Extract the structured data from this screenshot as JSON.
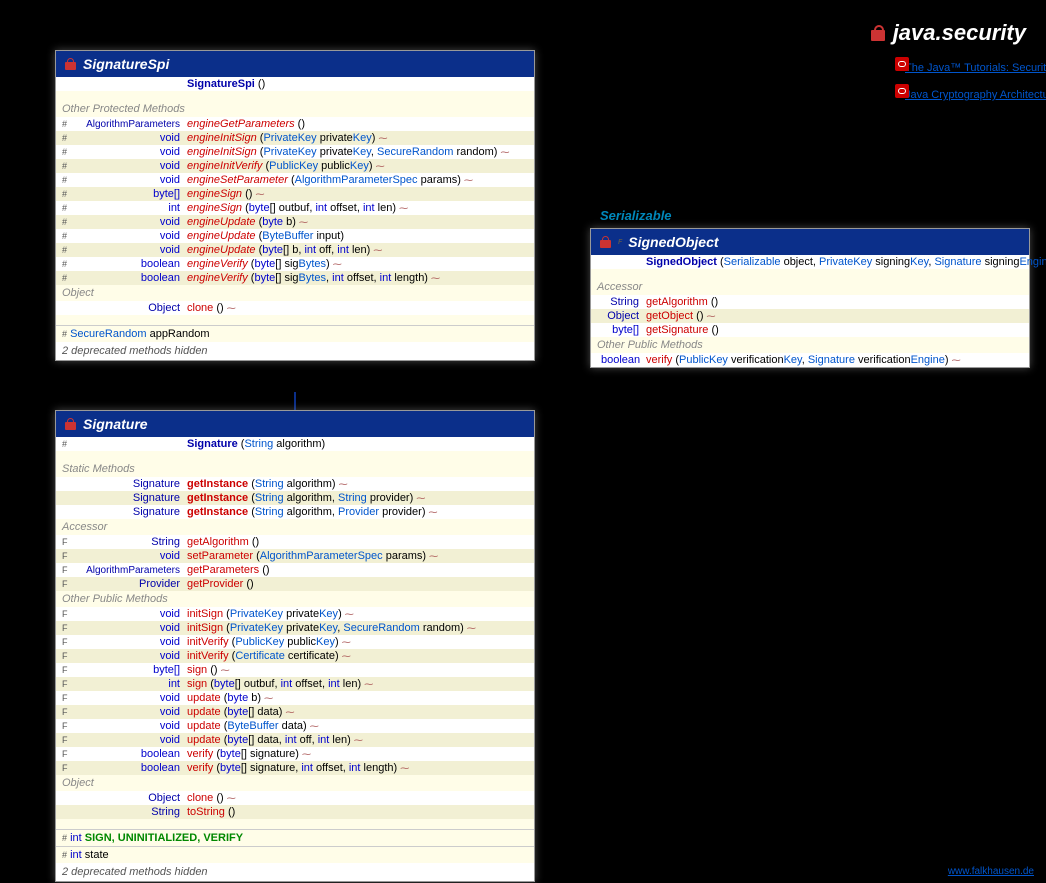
{
  "page": {
    "title": "java.security",
    "footer": "www.falkhausen.de"
  },
  "links": {
    "l1": "The Java™ Tutorials: Security Features in Java SE: Table of Contents",
    "l2": "Java Cryptography Architecture (JCA) Reference Guide"
  },
  "interface_label": "Serializable",
  "cards": {
    "sigspi": {
      "title": "SignatureSpi",
      "ctor": {
        "name": "SignatureSpi",
        "params": "()"
      },
      "sec1": "Other Protected Methods",
      "rows": [
        {
          "mod": "#",
          "ret": "AlgorithmParameters",
          "name": "engineGetParameters",
          "params": "()"
        },
        {
          "mod": "#",
          "ret": "void",
          "name": "engineInitSign",
          "params": "(PrivateKey privateKey)",
          "th": 1
        },
        {
          "mod": "#",
          "ret": "void",
          "name": "engineInitSign",
          "params": "(PrivateKey privateKey, SecureRandom random)",
          "th": 1
        },
        {
          "mod": "#",
          "ret": "void",
          "name": "engineInitVerify",
          "params": "(PublicKey publicKey)",
          "th": 1
        },
        {
          "mod": "#",
          "ret": "void",
          "name": "engineSetParameter",
          "params": "(AlgorithmParameterSpec params)",
          "th": 1
        },
        {
          "mod": "#",
          "ret": "byte[]",
          "name": "engineSign",
          "params": "()",
          "th": 1
        },
        {
          "mod": "#",
          "ret": "int",
          "name": "engineSign",
          "params": "(byte[] outbuf, int offset, int len)",
          "th": 1
        },
        {
          "mod": "#",
          "ret": "void",
          "name": "engineUpdate",
          "params": "(byte b)",
          "th": 1
        },
        {
          "mod": "#",
          "ret": "void",
          "name": "engineUpdate",
          "params": "(ByteBuffer input)"
        },
        {
          "mod": "#",
          "ret": "void",
          "name": "engineUpdate",
          "params": "(byte[] b, int off, int len)",
          "th": 1
        },
        {
          "mod": "#",
          "ret": "boolean",
          "name": "engineVerify",
          "params": "(byte[] sigBytes)",
          "th": 1
        },
        {
          "mod": "#",
          "ret": "boolean",
          "name": "engineVerify",
          "params": "(byte[] sigBytes, int offset, int length)",
          "th": 1
        }
      ],
      "sec2": "Object",
      "obj_rows": [
        {
          "mod": "",
          "ret": "Object",
          "name": "clone",
          "params": "()",
          "th": 1
        }
      ],
      "field": {
        "mod": "#",
        "type": "SecureRandom",
        "name": "appRandom"
      },
      "hidden": "2 deprecated methods hidden"
    },
    "sig": {
      "title": "Signature",
      "ctor": {
        "mod": "#",
        "name": "Signature",
        "params": "(String algorithm)"
      },
      "sec_static": "Static Methods",
      "static_rows": [
        {
          "ret": "Signature",
          "name": "getInstance",
          "params": "(String algorithm)",
          "th": 1
        },
        {
          "ret": "Signature",
          "name": "getInstance",
          "params": "(String algorithm, String provider)",
          "th": 1
        },
        {
          "ret": "Signature",
          "name": "getInstance",
          "params": "(String algorithm, Provider provider)",
          "th": 1
        }
      ],
      "sec_acc": "Accessor",
      "acc_rows": [
        {
          "mod": "F",
          "ret": "String",
          "name": "getAlgorithm",
          "params": "()"
        },
        {
          "mod": "F",
          "ret": "void",
          "name": "setParameter",
          "params": "(AlgorithmParameterSpec params)",
          "th": 1
        },
        {
          "mod": "F",
          "ret": "AlgorithmParameters",
          "name": "getParameters",
          "params": "()"
        },
        {
          "mod": "F",
          "ret": "Provider",
          "name": "getProvider",
          "params": "()"
        }
      ],
      "sec_pub": "Other Public Methods",
      "pub_rows": [
        {
          "mod": "F",
          "ret": "void",
          "name": "initSign",
          "params": "(PrivateKey privateKey)",
          "th": 1
        },
        {
          "mod": "F",
          "ret": "void",
          "name": "initSign",
          "params": "(PrivateKey privateKey, SecureRandom random)",
          "th": 1
        },
        {
          "mod": "F",
          "ret": "void",
          "name": "initVerify",
          "params": "(PublicKey publicKey)",
          "th": 1
        },
        {
          "mod": "F",
          "ret": "void",
          "name": "initVerify",
          "params": "(Certificate certificate)",
          "th": 1
        },
        {
          "mod": "F",
          "ret": "byte[]",
          "name": "sign",
          "params": "()",
          "th": 1
        },
        {
          "mod": "F",
          "ret": "int",
          "name": "sign",
          "params": "(byte[] outbuf, int offset, int len)",
          "th": 1
        },
        {
          "mod": "F",
          "ret": "void",
          "name": "update",
          "params": "(byte b)",
          "th": 1
        },
        {
          "mod": "F",
          "ret": "void",
          "name": "update",
          "params": "(byte[] data)",
          "th": 1
        },
        {
          "mod": "F",
          "ret": "void",
          "name": "update",
          "params": "(ByteBuffer data)",
          "th": 1
        },
        {
          "mod": "F",
          "ret": "void",
          "name": "update",
          "params": "(byte[] data, int off, int len)",
          "th": 1
        },
        {
          "mod": "F",
          "ret": "boolean",
          "name": "verify",
          "params": "(byte[] signature)",
          "th": 1
        },
        {
          "mod": "F",
          "ret": "boolean",
          "name": "verify",
          "params": "(byte[] signature, int offset, int length)",
          "th": 1
        }
      ],
      "sec_obj": "Object",
      "obj_rows": [
        {
          "ret": "Object",
          "name": "clone",
          "params": "()",
          "th": 1
        },
        {
          "ret": "String",
          "name": "toString",
          "params": "()"
        }
      ],
      "field1": {
        "mod": "#",
        "type": "int",
        "names": "SIGN, UNINITIALIZED, VERIFY"
      },
      "field2": {
        "mod": "#",
        "type": "int",
        "name": "state"
      },
      "hidden": "2 deprecated methods hidden"
    },
    "signed": {
      "title": "SignedObject",
      "ctor": {
        "name": "SignedObject",
        "params": "(Serializable object, PrivateKey signingKey, Signature signingEngine)",
        "th": 1
      },
      "sec_acc": "Accessor",
      "acc_rows": [
        {
          "ret": "String",
          "name": "getAlgorithm",
          "params": "()"
        },
        {
          "ret": "Object",
          "name": "getObject",
          "params": "()",
          "th": 1
        },
        {
          "ret": "byte[]",
          "name": "getSignature",
          "params": "()"
        }
      ],
      "sec_pub": "Other Public Methods",
      "pub_rows": [
        {
          "ret": "boolean",
          "name": "verify",
          "params": "(PublicKey verificationKey, Signature verificationEngine)",
          "th": 1
        }
      ]
    }
  }
}
